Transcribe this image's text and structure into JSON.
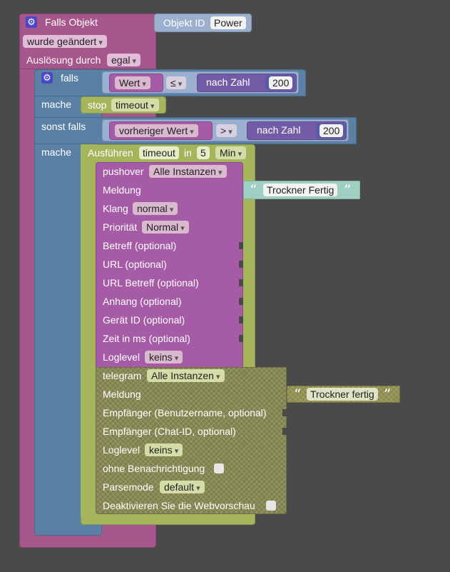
{
  "trigger": {
    "title": "Falls Objekt",
    "object_label": "Objekt ID",
    "object_value": "Power",
    "change_mode": "wurde geändert",
    "trigger_by_label": "Auslösung durch",
    "trigger_by_value": "egal"
  },
  "if_block": {
    "falls_label": "falls",
    "value_dd": "Wert",
    "op1": "≤",
    "to_number": "nach Zahl",
    "num1": "200",
    "mache1": "mache",
    "stop_label": "stop",
    "stop_value": "timeout",
    "elseif_label": "sonst falls",
    "prev_value_dd": "vorheriger Wert",
    "op2": ">",
    "to_number2": "nach Zahl",
    "num2": "200",
    "mache2": "mache"
  },
  "timeout_block": {
    "label": "Ausführen",
    "name": "timeout",
    "in_label": "in",
    "amount": "5",
    "unit": "Min"
  },
  "pushover": {
    "title": "pushover",
    "instance": "Alle Instanzen",
    "message_label": "Meldung",
    "message_value": "Trockner Fertig",
    "sound_label": "Klang",
    "sound_value": "normal",
    "priority_label": "Priorität",
    "priority_value": "Normal",
    "subject_label": "Betreff (optional)",
    "url_label": "URL (optional)",
    "url_subject_label": "URL Betreff (optional)",
    "attachment_label": "Anhang (optional)",
    "device_label": "Gerät ID (optional)",
    "time_label": "Zeit in ms (optional)",
    "loglevel_label": "Loglevel",
    "loglevel_value": "keins"
  },
  "telegram": {
    "title": "telegram",
    "instance": "Alle Instanzen",
    "message_label": "Meldung",
    "message_value": "Trockner fertig",
    "recipient_user_label": "Empfänger (Benutzername, optional)",
    "recipient_chat_label": "Empfänger (Chat-ID, optional)",
    "loglevel_label": "Loglevel",
    "loglevel_value": "keins",
    "silent_label": "ohne Benachrichtigung",
    "parsemode_label": "Parsemode",
    "parsemode_value": "default",
    "disable_preview_label": "Deaktivieren Sie die Webvorschau"
  }
}
